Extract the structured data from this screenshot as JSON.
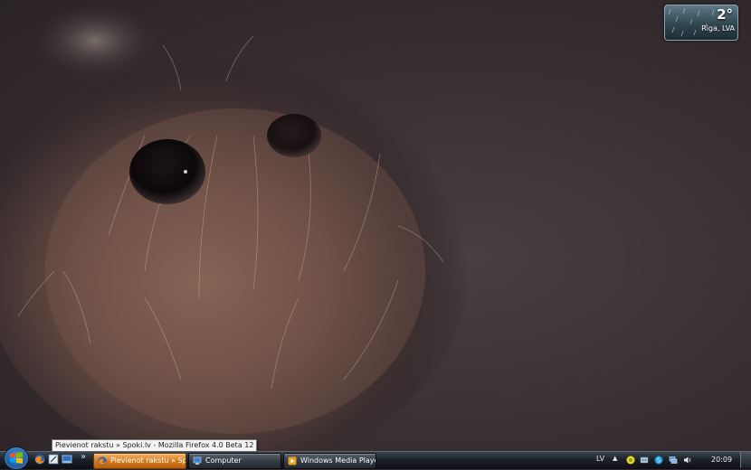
{
  "desktop": {
    "wallpaper_icon": "furry-creature-wallpaper"
  },
  "gadget": {
    "temperature": "2°",
    "location": "Riga, LVA",
    "icon": "rain-weather-icon"
  },
  "tooltip": {
    "text": "Pievienot rakstu » Spoki.lv - Mozilla Firefox 4.0 Beta 12"
  },
  "taskbar": {
    "start_icon": "windows-logo-icon",
    "quick_launch": [
      {
        "name": "firefox-icon"
      },
      {
        "name": "notepad-icon"
      },
      {
        "name": "show-desktop-icon"
      }
    ],
    "more_label": "»",
    "tasks": [
      {
        "label": "Pievienot rakstu » Spo...",
        "icon": "firefox-icon",
        "active": true
      },
      {
        "label": "Computer",
        "icon": "computer-icon",
        "active": false
      },
      {
        "label": "Windows Media Player",
        "icon": "media-player-icon",
        "active": false
      }
    ]
  },
  "tray": {
    "language": "LV",
    "expand_label": "▲",
    "icons": [
      "messenger-icon",
      "network-adapter-icon",
      "skype-icon",
      "network-icon",
      "volume-icon"
    ],
    "time": "20:09"
  }
}
